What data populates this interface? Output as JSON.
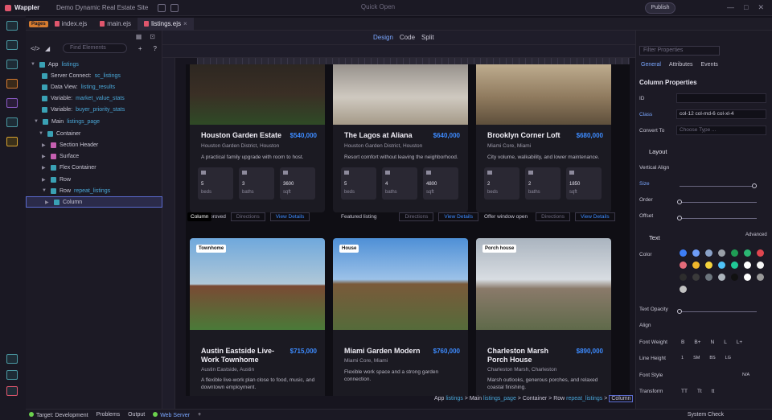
{
  "app": {
    "name": "Wappler",
    "project": "Demo Dynamic Real Estate Site",
    "search_placeholder": "Quick Open",
    "publish": "Publish"
  },
  "tabs": {
    "pages": "Pages",
    "items": [
      {
        "label": "index.ejs"
      },
      {
        "label": "main.ejs"
      },
      {
        "label": "listings.ejs"
      }
    ]
  },
  "tree": {
    "find_placeholder": "Find Elements",
    "nodes": [
      {
        "label": "App",
        "bind": "listings"
      },
      {
        "label": "Server Connect:",
        "bind": "sc_listings"
      },
      {
        "label": "Data View:",
        "bind": "listing_results"
      },
      {
        "label": "Variable:",
        "bind": "market_value_stats"
      },
      {
        "label": "Variable:",
        "bind": "buyer_priority_stats"
      },
      {
        "label": "Main",
        "bind": "listings_page"
      },
      {
        "label": "Container",
        "bind": ""
      },
      {
        "label": "Section Header",
        "bind": ""
      },
      {
        "label": "Surface",
        "bind": ""
      },
      {
        "label": "Flex Container",
        "bind": ""
      },
      {
        "label": "Row",
        "bind": ""
      },
      {
        "label": "Row",
        "bind": "repeat_listings"
      },
      {
        "label": "Column",
        "bind": ""
      }
    ]
  },
  "view": {
    "design": "Design",
    "code": "Code",
    "split": "Split"
  },
  "cards": [
    {
      "name": "Houston Garden Estate",
      "price": "$540,000",
      "loc": "Houston Garden District, Houston",
      "desc": "A practical family upgrade with room to host.",
      "beds": "5",
      "baths": "3",
      "sqft": "3600"
    },
    {
      "name": "The Lagos at Aliana",
      "price": "$640,000",
      "loc": "Houston Garden District, Houston",
      "desc": "Resort comfort without leaving the neighborhood.",
      "beds": "5",
      "baths": "4",
      "sqft": "4800"
    },
    {
      "name": "Brooklyn Corner Loft",
      "price": "$680,000",
      "loc": "Miami Core, Miami",
      "desc": "City volume, walkability, and lower maintenance.",
      "beds": "2",
      "baths": "2",
      "sqft": "1850"
    },
    {
      "tag": "Townhome",
      "name": "Austin Eastside Live-Work Townhome",
      "price": "$715,000",
      "loc": "Austin Eastside, Austin",
      "desc": "A flexible live-work plan close to food, music, and downtown employment."
    },
    {
      "tag": "House",
      "name": "Miami Garden Modern",
      "price": "$760,000",
      "loc": "Miami Core, Miami",
      "desc": "Flexible work space and a strong garden connection."
    },
    {
      "tag": "Porch house",
      "name": "Charleston Marsh Porch House",
      "price": "$890,000",
      "loc": "Charleston Marsh, Charleston",
      "desc": "Marsh outlooks, generous porches, and relaxed coastal finishing."
    }
  ],
  "stat_labels": {
    "beds": "beds",
    "baths": "baths",
    "sqft": "sqft"
  },
  "strips": [
    {
      "label": "proved"
    },
    {
      "label": "Featured listing"
    },
    {
      "label": "Offer window open"
    }
  ],
  "strip_buttons": {
    "directions": "Directions",
    "details": "View Details"
  },
  "column_tip": "Column",
  "breadcrumb": {
    "app": "App",
    "app_v": "listings",
    "main": "Main",
    "main_v": "listings_page",
    "container": "Container",
    "row": "Row",
    "row_v": "repeat_listings",
    "col": "Column",
    "sep": ">"
  },
  "props": {
    "filter": "Filter Properties",
    "tabs": [
      "General",
      "Attributes",
      "Events"
    ],
    "title": "Column Properties",
    "id_label": "ID",
    "class_label": "Class",
    "class_value": "col-12 col-md-6 col-xl-4",
    "convert_label": "Convert To",
    "convert_placeholder": "Choose Type ...",
    "layout": "Layout",
    "vertical_align": "Vertical Align",
    "size": "Size",
    "order": "Order",
    "offset": "Offset",
    "size_ticks": [
      "∞",
      "1",
      "6",
      "12"
    ],
    "order_ticks": [
      "D",
      "F",
      "1",
      "12"
    ],
    "offset_ticks": [
      "0",
      "3",
      "6",
      "9",
      "12"
    ],
    "text": "Text",
    "advanced": "Advanced",
    "color": "Color",
    "text_opacity": "Text Opacity",
    "opacity_ticks": [
      "0",
      "25%",
      "50%",
      "75%",
      "100%"
    ],
    "align": "Align",
    "font_weight": "Font Weight",
    "fw": [
      "B",
      "B+",
      "N",
      "L",
      "L+"
    ],
    "line_height": "Line Height",
    "lh": [
      "1",
      "SM",
      "BS",
      "LG"
    ],
    "font_style": "Font Style",
    "na": "N/A",
    "transform": "Transform",
    "tf": [
      "TT",
      "Tt",
      "tt"
    ],
    "swatches": [
      "#3d7ef7",
      "#6e9cf7",
      "#8aa2c8",
      "#9aa0a8",
      "#1f9d55",
      "#2bb673",
      "#e0464f",
      "#e46b7a",
      "#f0b62b",
      "#f3d23c",
      "#4fc3f7",
      "#20c997",
      "#ffffff",
      "#f5f5f5",
      "#2d2d2d",
      "#3a3a3a",
      "#6c757d",
      "#adb5bd",
      "#111111",
      "#ffffff",
      "#999999",
      "#c2c2c2"
    ]
  },
  "status": {
    "target": "Target: Development",
    "problems": "Problems",
    "output": "Output",
    "web_server": "Web Server",
    "system_check": "System Check"
  }
}
